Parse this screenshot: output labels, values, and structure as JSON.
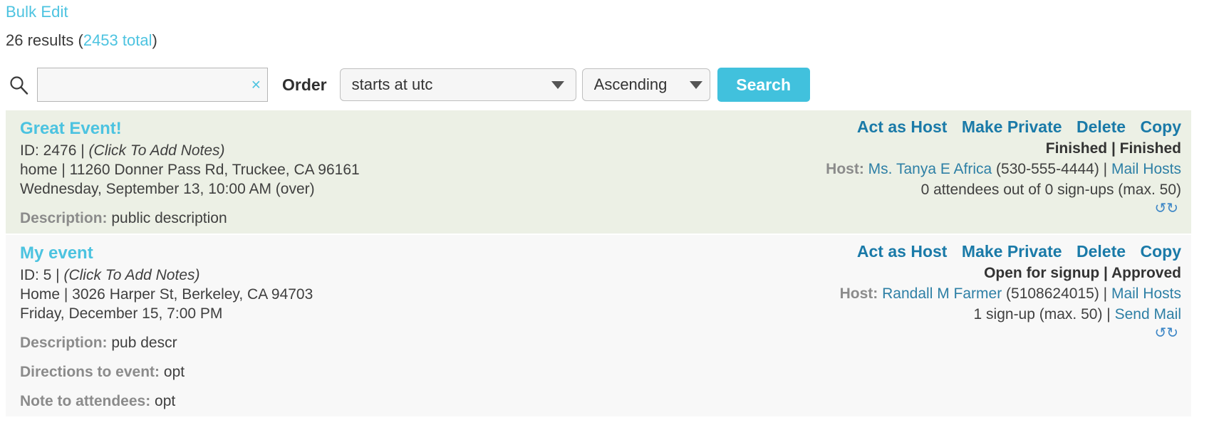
{
  "header": {
    "breadcrumb": "Bulk Edit",
    "results_prefix": "26 results (",
    "results_total": "2453 total",
    "results_suffix": ")"
  },
  "search": {
    "icon": "search-icon",
    "value": "",
    "placeholder": "",
    "clear_label": "×",
    "order_label": "Order",
    "order_by_value": "starts at utc",
    "direction_value": "Ascending",
    "submit_label": "Search",
    "accent_color": "#41c1dd",
    "link_color": "#4cc3e0"
  },
  "events": [
    {
      "title": "Great Event!",
      "id_text": "ID: 2476 |",
      "notes_link": "(Click To Add Notes)",
      "location": "home | 11260 Donner Pass Rd, Truckee, CA 96161",
      "datetime": "Wednesday, September 13, 10:00 AM (over)",
      "fields": [
        {
          "key": "Description:",
          "value": "public description"
        }
      ],
      "actions": [
        "Act as Host",
        "Make Private",
        "Delete",
        "Copy"
      ],
      "status": "Finished | Finished",
      "host_label": "Host:",
      "host_name": "Ms. Tanya E Africa",
      "host_phone": "(530-555-4444)",
      "host_sep": "|",
      "mail_hosts": "Mail Hosts",
      "signups_text": "0 attendees out of 0 sign-ups (max. 50)",
      "signups_sep": "",
      "send_mail": "",
      "refresh_icon": "refresh-icon",
      "background": "#ecf0e5"
    },
    {
      "title": "My event",
      "id_text": "ID: 5 |",
      "notes_link": "(Click To Add Notes)",
      "location": "Home | 3026 Harper St, Berkeley, CA 94703",
      "datetime": "Friday, December 15, 7:00 PM",
      "fields": [
        {
          "key": "Description:",
          "value": "pub descr"
        },
        {
          "key": "Directions to event:",
          "value": "opt"
        },
        {
          "key": "Note to attendees:",
          "value": "opt"
        }
      ],
      "actions": [
        "Act as Host",
        "Make Private",
        "Delete",
        "Copy"
      ],
      "status": "Open for signup | Approved",
      "host_label": "Host:",
      "host_name": "Randall M Farmer",
      "host_phone": "(5108624015)",
      "host_sep": "|",
      "mail_hosts": "Mail Hosts",
      "signups_text": "1 sign-up (max. 50)",
      "signups_sep": "|",
      "send_mail": "Send Mail",
      "refresh_icon": "refresh-icon",
      "background": "#f8f8f8"
    }
  ]
}
